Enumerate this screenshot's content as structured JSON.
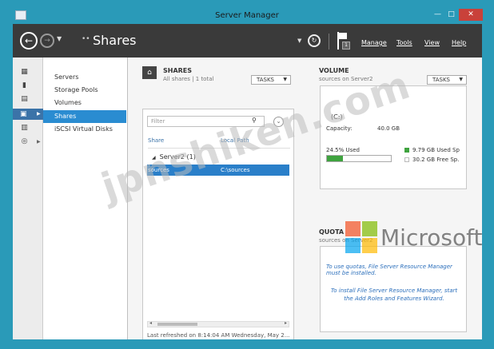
{
  "window": {
    "title": "Server Manager",
    "controls": {
      "minimize": "—",
      "maximize": "□",
      "close": "✕"
    }
  },
  "header": {
    "breadcrumb_prefix": "••",
    "page_title": "Shares",
    "flag_badge": "1",
    "menu": [
      "Manage",
      "Tools",
      "View",
      "Help"
    ]
  },
  "sidebar": {
    "items": [
      "Servers",
      "Storage Pools",
      "Volumes",
      "Shares",
      "iSCSI Virtual Disks"
    ],
    "active": "Shares"
  },
  "shares": {
    "title": "SHARES",
    "subtitle": "All shares | 1 total",
    "tasks_label": "TASKS",
    "filter_placeholder": "Filter",
    "columns": [
      "Share",
      "Local Path"
    ],
    "group": "Server2 (1)",
    "rows": [
      {
        "share": "sources",
        "path": "C:\\sources"
      }
    ],
    "last_refreshed": "Last refreshed on 8:14:04 AM Wednesday, May 2..."
  },
  "volume": {
    "title": "VOLUME",
    "subtitle": "sources on Server2",
    "tasks_label": "TASKS",
    "drive": "(C:)",
    "capacity_label": "Capacity:",
    "capacity_value": "40.0 GB",
    "used_pct_label": "24.5% Used",
    "used_fraction": 0.245,
    "used_label": "9.79 GB Used Sp",
    "free_label": "30.2 GB Free Sp.",
    "colors": {
      "used": "#3fa33f",
      "free": "#ffffff"
    }
  },
  "quota": {
    "title": "QUOTA",
    "subtitle": "sources on Server2",
    "message_line1": "To use quotas, File Server Resource Manager must be installed.",
    "message_line2": "To install File Server Resource Manager, start the Add Roles and Features Wizard."
  },
  "overlay": {
    "watermark": "jpnshiken.com",
    "logo_text": "Microsoft"
  },
  "colors": {
    "window_frame": "#2a9ab8",
    "header_bar": "#3a3a3a",
    "selection": "#2a7fc9",
    "sidebar_active": "#2a8cd1",
    "close_button": "#c9413a"
  }
}
